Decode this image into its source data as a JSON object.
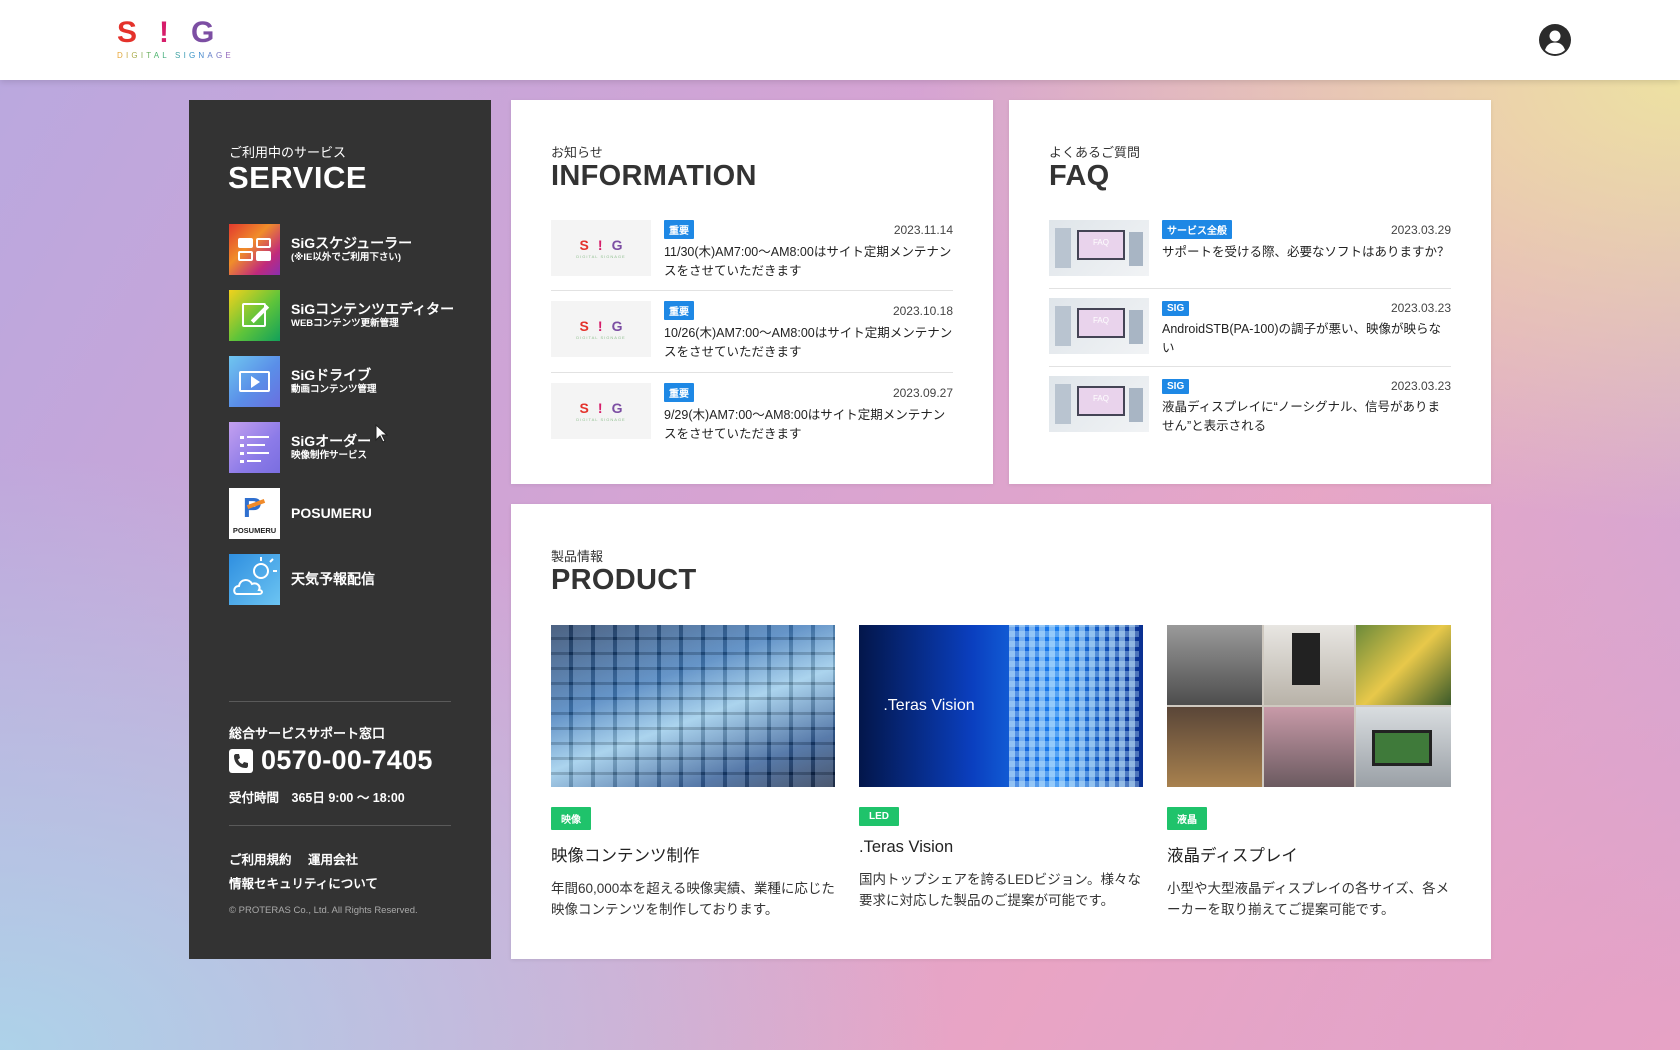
{
  "header": {
    "logo_letters": [
      "S",
      "!",
      "G"
    ],
    "logo_sub": "DIGITAL SIGNAGE",
    "account_icon": "user-circle-icon"
  },
  "sidebar": {
    "kicker": "ご利用中のサービス",
    "title": "SERVICE",
    "items": [
      {
        "name": "SiGスケジューラー",
        "sub": "(※IE以外でご利用下さい)",
        "icon": "scheduler-icon"
      },
      {
        "name": "SiGコンテンツエディター",
        "sub": "WEBコンテンツ更新管理",
        "icon": "editor-icon"
      },
      {
        "name": "SiGドライブ",
        "sub": "動画コンテンツ管理",
        "icon": "drive-icon"
      },
      {
        "name": "SiGオーダー",
        "sub": "映像制作サービス",
        "icon": "order-icon"
      },
      {
        "name": "POSUMERU",
        "sub": "",
        "icon": "posumeru-logo-icon"
      },
      {
        "name": "天気予報配信",
        "sub": "",
        "icon": "weather-icon"
      }
    ],
    "support_title": "総合サービスサポート窓口",
    "phone": "0570-00-7405",
    "hours": "受付時間　365日 9:00 〜 18:00",
    "links": [
      "ご利用規約",
      "運用会社",
      "情報セキュリティについて"
    ],
    "copyright": "© PROTERAS Co., Ltd. All Rights Reserved."
  },
  "information": {
    "kicker": "お知らせ",
    "title": "INFORMATION",
    "items": [
      {
        "badge": "重要",
        "date": "2023.11.14",
        "text": "11/30(木)AM7:00〜AM8:00はサイト定期メンテナンスをさせていただきます"
      },
      {
        "badge": "重要",
        "date": "2023.10.18",
        "text": "10/26(木)AM7:00〜AM8:00はサイト定期メンテナンスをさせていただきます"
      },
      {
        "badge": "重要",
        "date": "2023.09.27",
        "text": "9/29(木)AM7:00〜AM8:00はサイト定期メンテナンスをさせていただきます"
      }
    ],
    "thumb_logo_sub": "DIGITAL SIGNAGE"
  },
  "faq": {
    "kicker": "よくあるご質問",
    "title": "FAQ",
    "thumb_label": "FAQ",
    "items": [
      {
        "badge": "サービス全般",
        "date": "2023.03.29",
        "text": "サポートを受ける際、必要なソフトはありますか？"
      },
      {
        "badge": "SIG",
        "date": "2023.03.23",
        "text": "AndroidSTB(PA-100)の調子が悪い、映像が映らない"
      },
      {
        "badge": "SIG",
        "date": "2023.03.23",
        "text": "液晶ディスプレイに“ノーシグナル、信号がありません”と表示される"
      }
    ]
  },
  "product": {
    "kicker": "製品情報",
    "title": "PRODUCT",
    "items": [
      {
        "badge": "映像",
        "name": "映像コンテンツ制作",
        "desc": "年間60,000本を超える映像実績、業種に応じた映像コンテンツを制作しております。",
        "image": "video-wall-image"
      },
      {
        "badge": "LED",
        "name": ".Teras Vision",
        "desc": "国内トップシェアを誇るLEDビジョン。様々な要求に対応した製品のご提案が可能です。",
        "image_text": ".Teras Vision",
        "image": "led-vision-image"
      },
      {
        "badge": "液晶",
        "name": "液晶ディスプレイ",
        "desc": "小型や大型液晶ディスプレイの各サイズ、各メーカーを取り揃えてご提案可能です。",
        "image": "lcd-display-collage-image"
      }
    ]
  },
  "colors": {
    "sidebar_bg": "#333333",
    "badge_blue": "#1e88e5",
    "badge_green": "#1fc36b"
  }
}
